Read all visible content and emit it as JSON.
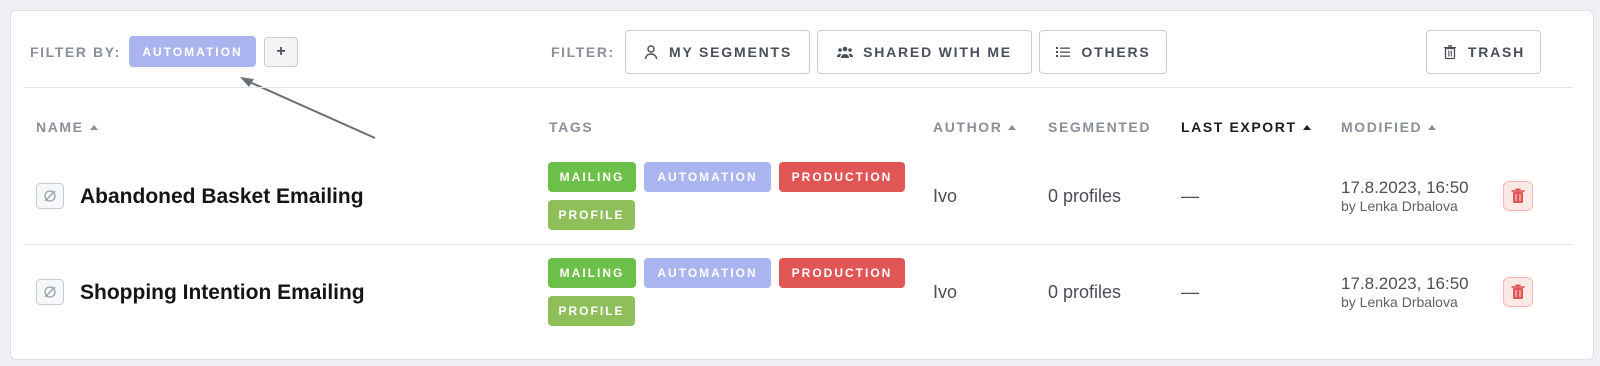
{
  "filter_by": {
    "label": "FILTER BY:",
    "active_tag": "AUTOMATION",
    "add_label": "+"
  },
  "filter": {
    "label": "FILTER:",
    "my_segments": "MY SEGMENTS",
    "shared_with_me": "SHARED WITH ME",
    "others": "OTHERS",
    "trash": "TRASH"
  },
  "columns": {
    "name": "NAME",
    "tags": "TAGS",
    "author": "AUTHOR",
    "segmented": "SEGMENTED",
    "last_export": "LAST EXPORT",
    "modified": "MODIFIED"
  },
  "rows": [
    {
      "name": "Abandoned Basket Emailing",
      "tags": [
        "MAILING",
        "AUTOMATION",
        "PRODUCTION",
        "PROFILE"
      ],
      "author": "Ivo",
      "segmented": "0 profiles",
      "last_export": "—",
      "modified_date": "17.8.2023, 16:50",
      "modified_by": "by Lenka Drbalova"
    },
    {
      "name": "Shopping Intention Emailing",
      "tags": [
        "MAILING",
        "AUTOMATION",
        "PRODUCTION",
        "PROFILE"
      ],
      "author": "Ivo",
      "segmented": "0 profiles",
      "last_export": "—",
      "modified_date": "17.8.2023, 16:50",
      "modified_by": "by Lenka Drbalova"
    }
  ],
  "colors": {
    "mailing": "#6cc04a",
    "automation": "#aab4ee",
    "production": "#e05555",
    "profile": "#8fbf5a"
  },
  "icons": [
    "user-icon",
    "group-icon",
    "list-icon",
    "trash-icon",
    "eye-slash-icon",
    "delete-icon",
    "plus-icon"
  ]
}
